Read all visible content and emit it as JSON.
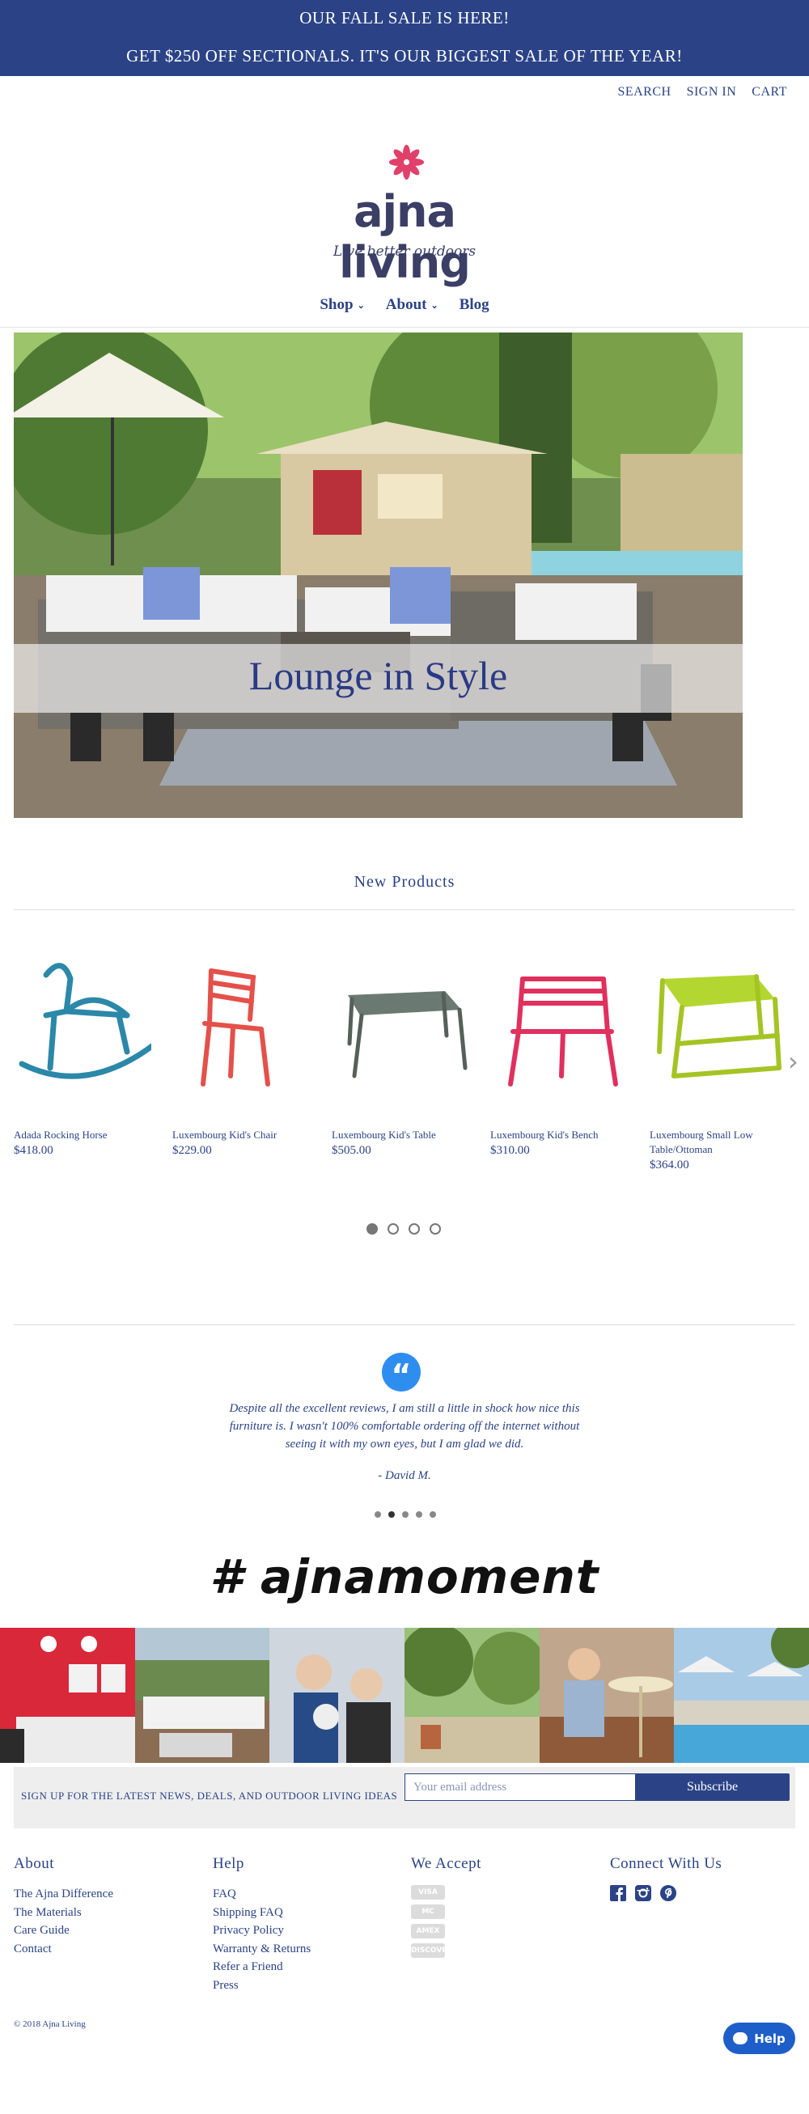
{
  "promo": {
    "line1": "OUR FALL SALE IS HERE!",
    "line2": "GET $250 OFF SECTIONALS. IT'S OUR BIGGEST SALE OF THE YEAR!"
  },
  "topnav": {
    "search": "SEARCH",
    "signin": "SIGN IN",
    "cart": "CART"
  },
  "logo": {
    "wordmark": "ajna living",
    "tagline": "Live better outdoors"
  },
  "mainnav": {
    "shop": "Shop",
    "about": "About",
    "blog": "Blog"
  },
  "hero": {
    "caption": "Lounge in Style"
  },
  "products": {
    "title": "New Products",
    "items": [
      {
        "name": "Adada Rocking Horse",
        "price": "$418.00"
      },
      {
        "name": "Luxembourg Kid's Chair",
        "price": "$229.00"
      },
      {
        "name": "Luxembourg Kid's Table",
        "price": "$505.00"
      },
      {
        "name": "Luxembourg Kid's Bench",
        "price": "$310.00"
      },
      {
        "name": "Luxembourg Small Low Table/Ottoman",
        "price": "$364.00"
      }
    ]
  },
  "testimonial": {
    "text": "Despite all the excellent reviews, I am still a little in shock how nice this furniture is. I wasn't 100% comfortable ordering off the internet without seeing it with my own eyes, but I am glad we did.",
    "author": "- David M."
  },
  "hashtag": "# ajnamoment",
  "signup": {
    "label": "SIGN UP FOR THE LATEST NEWS, DEALS, AND OUTDOOR LIVING IDEAS",
    "placeholder": "Your email address",
    "button": "Subscribe"
  },
  "footer": {
    "about": {
      "heading": "About",
      "links": [
        "The Ajna Difference",
        "The Materials",
        "Care Guide",
        "Contact"
      ]
    },
    "help": {
      "heading": "Help",
      "links": [
        "FAQ",
        "Shipping FAQ",
        "Privacy Policy",
        "Warranty & Returns",
        "Refer a Friend",
        "Press"
      ]
    },
    "accept": {
      "heading": "We Accept",
      "cards": [
        "VISA",
        "MC",
        "AMEX",
        "DISCOVER"
      ]
    },
    "connect": {
      "heading": "Connect With Us",
      "icons": [
        "facebook-icon",
        "instagram-icon",
        "pinterest-icon"
      ]
    }
  },
  "copyright": "© 2018 Ajna Living",
  "help_button": "Help",
  "colors": {
    "brand": "#2b4386",
    "accent": "#e0406a",
    "help": "#1e5ec8"
  }
}
